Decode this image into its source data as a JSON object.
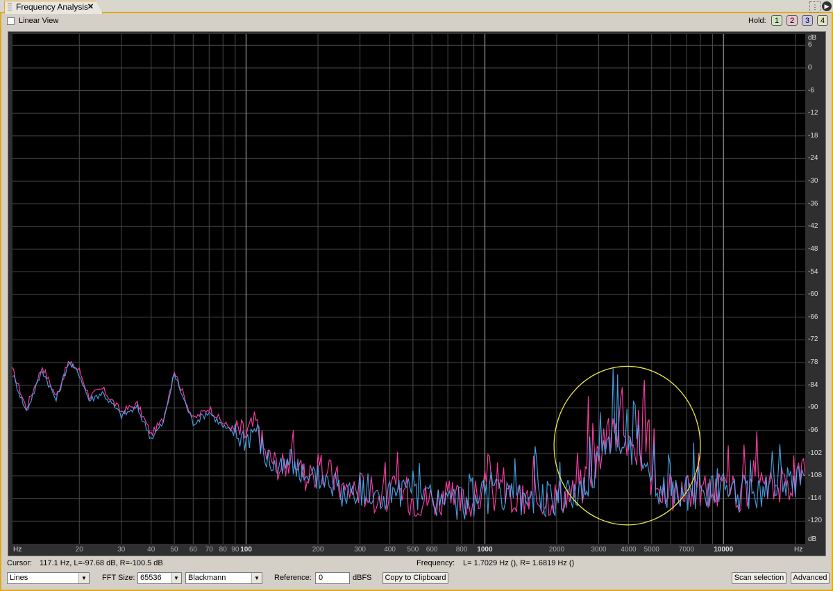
{
  "window": {
    "tab_title": "Frequency Analysis",
    "close_glyph": "✕"
  },
  "toolbar": {
    "linear_view_label": "Linear View",
    "linear_view_checked": false,
    "hold_label": "Hold:",
    "hold_buttons": [
      {
        "label": "1",
        "color": "#cfe3c3"
      },
      {
        "label": "2",
        "color": "#e9c3cc"
      },
      {
        "label": "3",
        "color": "#c9c3e9"
      },
      {
        "label": "4",
        "color": "#e2e2c3"
      }
    ]
  },
  "graph": {
    "y_unit": "dB",
    "y_ticks": [
      "6",
      "0",
      "-6",
      "-12",
      "-18",
      "-24",
      "-30",
      "-36",
      "-42",
      "-48",
      "-54",
      "-60",
      "-66",
      "-72",
      "-78",
      "-84",
      "-90",
      "-96",
      "-102",
      "-108",
      "-114",
      "-120"
    ],
    "x_unit": "Hz",
    "x_ticks": [
      {
        "label": "20",
        "value": 20,
        "major": false
      },
      {
        "label": "30",
        "value": 30,
        "major": false
      },
      {
        "label": "40",
        "value": 40,
        "major": false
      },
      {
        "label": "50",
        "value": 50,
        "major": false
      },
      {
        "label": "60",
        "value": 60,
        "major": false
      },
      {
        "label": "70",
        "value": 70,
        "major": false
      },
      {
        "label": "80",
        "value": 80,
        "major": false
      },
      {
        "label": "90",
        "value": 90,
        "major": false
      },
      {
        "label": "100",
        "value": 100,
        "major": true
      },
      {
        "label": "200",
        "value": 200,
        "major": false
      },
      {
        "label": "300",
        "value": 300,
        "major": false
      },
      {
        "label": "400",
        "value": 400,
        "major": false
      },
      {
        "label": "500",
        "value": 500,
        "major": false
      },
      {
        "label": "600",
        "value": 600,
        "major": false
      },
      {
        "label": "800",
        "value": 800,
        "major": false
      },
      {
        "label": "1000",
        "value": 1000,
        "major": true
      },
      {
        "label": "2000",
        "value": 2000,
        "major": false
      },
      {
        "label": "3000",
        "value": 3000,
        "major": false
      },
      {
        "label": "4000",
        "value": 4000,
        "major": false
      },
      {
        "label": "5000",
        "value": 5000,
        "major": false
      },
      {
        "label": "7000",
        "value": 7000,
        "major": false
      },
      {
        "label": "10000",
        "value": 10000,
        "major": true
      }
    ],
    "colors": {
      "left_channel": "#ff3fa8",
      "right_channel": "#4fb4ff",
      "highlight_circle": "#e8e84a",
      "grid": "#4a4a4a"
    }
  },
  "chart_data": {
    "type": "line",
    "x_scale": "log",
    "xlim": [
      10.5,
      22000
    ],
    "ylim": [
      -126,
      9
    ],
    "xlabel": "Hz",
    "ylabel": "dB",
    "grid": true,
    "annotations": [
      {
        "type": "ellipse",
        "x_range": [
          1950,
          8000
        ],
        "y_range": [
          -121,
          -79
        ]
      }
    ],
    "series": [
      {
        "color": "#ff3fa8",
        "x": [
          10.5,
          12,
          14,
          16,
          18,
          20,
          22,
          25,
          30,
          35,
          40,
          45,
          50,
          55,
          60,
          70,
          80,
          90,
          100,
          110,
          120,
          140,
          160,
          180,
          200,
          230,
          260,
          300,
          350,
          400,
          450,
          500,
          600,
          700,
          800,
          900,
          1000,
          1200,
          1400,
          1600,
          1800,
          2000,
          2300,
          2600,
          3000,
          3300,
          3600,
          4000,
          4400,
          4800,
          5200,
          5800,
          6500,
          7500,
          8500,
          10000,
          12000,
          14000,
          16000,
          18000,
          20000,
          22000
        ],
        "y": [
          -80,
          -90,
          -79,
          -87,
          -78,
          -80,
          -87,
          -85,
          -91,
          -89,
          -97,
          -93,
          -80,
          -87,
          -93,
          -90,
          -94,
          -96,
          -97,
          -94,
          -102,
          -106,
          -103,
          -109,
          -107,
          -108,
          -112,
          -111,
          -113,
          -113,
          -112,
          -114,
          -114,
          -114,
          -115,
          -114,
          -113,
          -113,
          -115,
          -114,
          -114,
          -113,
          -113,
          -110,
          -103,
          -97,
          -96,
          -99,
          -101,
          -107,
          -111,
          -113,
          -113,
          -112,
          -112,
          -112,
          -113,
          -112,
          -111,
          -110,
          -109,
          -108
        ]
      },
      {
        "color": "#4fb4ff",
        "x": [
          10.5,
          12,
          14,
          16,
          18,
          20,
          22,
          25,
          30,
          35,
          40,
          45,
          50,
          55,
          60,
          70,
          80,
          90,
          100,
          110,
          120,
          140,
          160,
          180,
          200,
          230,
          260,
          300,
          350,
          400,
          450,
          500,
          600,
          700,
          800,
          900,
          1000,
          1200,
          1400,
          1600,
          1800,
          2000,
          2300,
          2600,
          3000,
          3300,
          3600,
          4000,
          4400,
          4800,
          5200,
          5800,
          6500,
          7500,
          8500,
          10000,
          12000,
          14000,
          16000,
          18000,
          20000,
          22000
        ],
        "y": [
          -81,
          -91,
          -80,
          -88,
          -78,
          -81,
          -88,
          -86,
          -92,
          -90,
          -98,
          -94,
          -81,
          -88,
          -94,
          -91,
          -95,
          -97,
          -98,
          -95,
          -103,
          -107,
          -104,
          -110,
          -108,
          -109,
          -113,
          -112,
          -114,
          -113,
          -113,
          -114,
          -114,
          -115,
          -115,
          -114,
          -114,
          -114,
          -115,
          -114,
          -114,
          -114,
          -113,
          -111,
          -105,
          -99,
          -98,
          -100,
          -102,
          -108,
          -112,
          -113,
          -113,
          -112,
          -112,
          -112,
          -113,
          -112,
          -111,
          -110,
          -109,
          -108
        ]
      }
    ]
  },
  "status": {
    "cursor_label": "Cursor:",
    "cursor_value": "117.1 Hz, L=-97.68 dB, R=-100.5 dB",
    "frequency_label": "Frequency:",
    "frequency_value": "L= 1.7029 Hz (), R= 1.6819 Hz ()"
  },
  "controls": {
    "display_mode": "Lines",
    "fft_label": "FFT Size:",
    "fft_size": "65536",
    "window": "Blackmann",
    "reference_label": "Reference:",
    "reference_value": "0",
    "reference_unit": "dBFS",
    "copy_button": "Copy to Clipboard",
    "scan_button": "Scan selection",
    "advanced_button": "Advanced"
  }
}
